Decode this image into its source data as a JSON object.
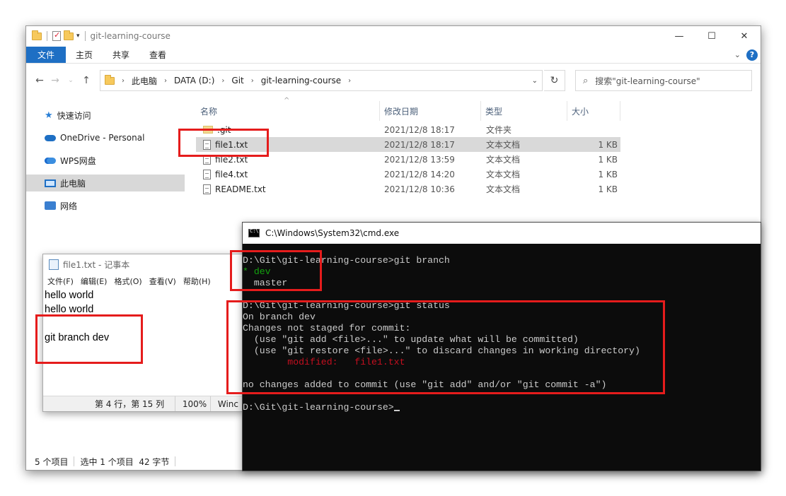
{
  "explorer": {
    "title": "git-learning-course",
    "window_controls": [
      "—",
      "☐",
      "✕"
    ],
    "ribbon_tabs": [
      "文件",
      "主页",
      "共享",
      "查看"
    ],
    "address": {
      "crumbs": [
        "此电脑",
        "DATA (D:)",
        "Git",
        "git-learning-course"
      ]
    },
    "search_placeholder": "搜索\"git-learning-course\"",
    "nav_items": [
      "快速访问",
      "OneDrive - Personal",
      "WPS网盘",
      "此电脑",
      "网络"
    ],
    "columns": [
      "名称",
      "修改日期",
      "类型",
      "大小"
    ],
    "files": [
      {
        "name": ".git",
        "date": "2021/12/8 18:17",
        "type": "文件夹",
        "size": ""
      },
      {
        "name": "file1.txt",
        "date": "2021/12/8 18:17",
        "type": "文本文档",
        "size": "1 KB"
      },
      {
        "name": "file2.txt",
        "date": "2021/12/8 13:59",
        "type": "文本文档",
        "size": "1 KB"
      },
      {
        "name": "file4.txt",
        "date": "2021/12/8 14:20",
        "type": "文本文档",
        "size": "1 KB"
      },
      {
        "name": "README.txt",
        "date": "2021/12/8 10:36",
        "type": "文本文档",
        "size": "1 KB"
      }
    ],
    "status": {
      "count": "5 个项目",
      "selected": "选中 1 个项目  42 字节"
    }
  },
  "notepad": {
    "title": "file1.txt - 记事本",
    "menu": [
      "文件(F)",
      "编辑(E)",
      "格式(O)",
      "查看(V)",
      "帮助(H)"
    ],
    "lines": [
      "hello world",
      "hello world",
      "",
      "git branch dev"
    ],
    "status": {
      "position": "第 4 行，第 15 列",
      "zoom": "100%",
      "encoding": "Winc"
    }
  },
  "cmd": {
    "title": "C:\\Windows\\System32\\cmd.exe",
    "lines": {
      "l1": "D:\\Git\\git-learning-course>git branch",
      "l2": "* dev",
      "l3": "  master",
      "l4": "D:\\Git\\git-learning-course>git status",
      "l5": "On branch dev",
      "l6": "Changes not staged for commit:",
      "l7": "  (use \"git add <file>...\" to update what will be committed)",
      "l8": "  (use \"git restore <file>...\" to discard changes in working directory)",
      "l9": "        modified:   file1.txt",
      "l10": "no changes added to commit (use \"git add\" and/or \"git commit -a\")",
      "l11": "D:\\Git\\git-learning-course>"
    }
  },
  "colors": {
    "accent": "#1e6fc4",
    "annotation": "#e51c1c",
    "term_green": "#13a10e",
    "term_red": "#c50f1f"
  }
}
